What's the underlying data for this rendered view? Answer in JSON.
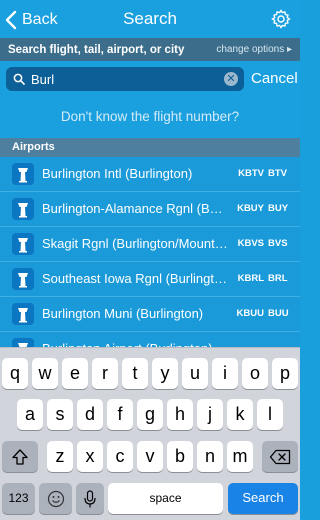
{
  "nav": {
    "back_label": "Back",
    "title": "Search"
  },
  "hint": {
    "text": "Search flight, tail, airport, or city",
    "change_options": "change options ▸"
  },
  "search": {
    "value": "Burl",
    "cancel_label": "Cancel"
  },
  "help_link": "Don't know the flight number?",
  "section": {
    "title": "Airports"
  },
  "airports": [
    {
      "name": "Burlington Intl (Burlington)",
      "icao": "KBTV",
      "iata": "BTV"
    },
    {
      "name": "Burlington-Alamance Rgnl (Burlington)",
      "icao": "KBUY",
      "iata": "BUY"
    },
    {
      "name": "Skagit Rgnl (Burlington/Mount Vernon)",
      "icao": "KBVS",
      "iata": "BVS"
    },
    {
      "name": "Southeast Iowa Rgnl (Burlington)",
      "icao": "KBRL",
      "iata": "BRL"
    },
    {
      "name": "Burlington Muni (Burlington)",
      "icao": "KBUU",
      "iata": "BUU"
    },
    {
      "name": "Burlington Airport (Burlington)",
      "icao": "",
      "iata": ""
    }
  ],
  "keyboard": {
    "row1": [
      "q",
      "w",
      "e",
      "r",
      "t",
      "y",
      "u",
      "i",
      "o",
      "p"
    ],
    "row2": [
      "a",
      "s",
      "d",
      "f",
      "g",
      "h",
      "j",
      "k",
      "l"
    ],
    "row3": [
      "z",
      "x",
      "c",
      "v",
      "b",
      "n",
      "m"
    ],
    "numbers_label": "123",
    "space_label": "space",
    "search_label": "Search"
  },
  "colors": {
    "nav_blue": "#1aa0de",
    "hint_bar": "#3c6e8c",
    "section_header": "#4f7f9e",
    "search_key": "#1a84e6"
  },
  "icons": [
    "chevron-left-icon",
    "gear-icon",
    "search-icon",
    "clear-icon",
    "airport-tower-icon",
    "shift-icon",
    "backspace-icon",
    "emoji-icon",
    "microphone-icon"
  ]
}
